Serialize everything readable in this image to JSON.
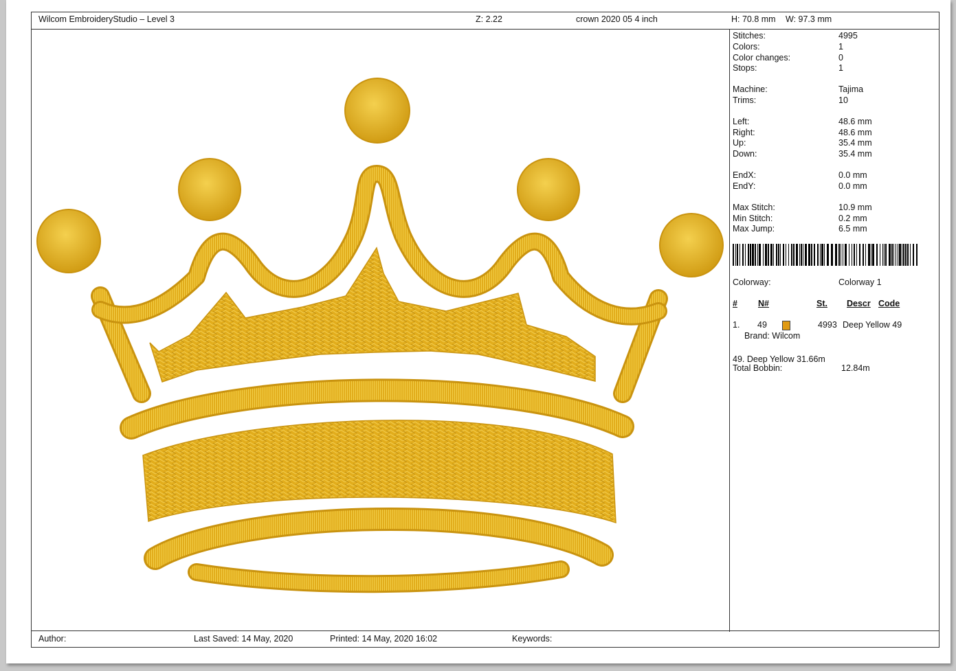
{
  "header": {
    "app_title": "Wilcom EmbroideryStudio – Level 3",
    "zoom": "Z: 2.22",
    "design_name": "crown 2020 05 4 inch",
    "height": "H: 70.8 mm",
    "width": "W: 97.3 mm"
  },
  "stats": [
    {
      "label": "Stitches:",
      "value": "4995"
    },
    {
      "label": "Colors:",
      "value": "1"
    },
    {
      "label": "Color changes:",
      "value": "0"
    },
    {
      "label": "Stops:",
      "value": "1"
    },
    {
      "label": "Machine:",
      "value": "Tajima"
    },
    {
      "label": "Trims:",
      "value": "10"
    },
    {
      "label": "Left:",
      "value": "48.6 mm"
    },
    {
      "label": "Right:",
      "value": "48.6 mm"
    },
    {
      "label": "Up:",
      "value": "35.4 mm"
    },
    {
      "label": "Down:",
      "value": "35.4 mm"
    },
    {
      "label": "EndX:",
      "value": "0.0 mm"
    },
    {
      "label": "EndY:",
      "value": "0.0 mm"
    },
    {
      "label": "Max Stitch:",
      "value": "10.9 mm"
    },
    {
      "label": "Min Stitch:",
      "value": "0.2 mm"
    },
    {
      "label": "Max Jump:",
      "value": "6.5 mm"
    }
  ],
  "colorway": {
    "label": "Colorway:",
    "value": "Colorway 1"
  },
  "color_table": {
    "headers": [
      "#",
      "N#",
      "St.",
      "Descr",
      "Code"
    ],
    "rows": [
      {
        "index": "1.",
        "number": "49",
        "swatch_color": "#e09a12",
        "stitches": "4993",
        "description": "Deep Yellow 49",
        "brand": "Brand: Wilcom"
      }
    ]
  },
  "thread_usage": "49. Deep Yellow 31.66m",
  "bobbin": {
    "label": "Total Bobbin:",
    "value": "12.84m"
  },
  "footer": {
    "author": "Author:",
    "last_saved": "Last Saved: 14 May, 2020",
    "printed": "Printed: 14 May, 2020 16:02",
    "keywords": "Keywords:"
  },
  "colors": {
    "thread": "#e2ad1c",
    "thread_dark": "#b8860b",
    "thread_light": "#f2cf4a"
  },
  "design_image": {
    "icon": "embroidered-crown"
  }
}
